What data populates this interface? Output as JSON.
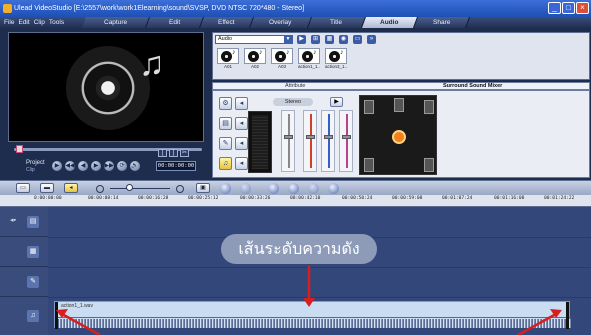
{
  "window": {
    "title": "Ulead VideoStudio [E:\\2557\\work\\work1Elearning\\sound\\SVSP, DVD NTSC 720*480 - Stereo]",
    "buttons": [
      "_",
      "□",
      "×"
    ]
  },
  "menu": [
    "File",
    "Edit",
    "Clip",
    "Tools"
  ],
  "steps": {
    "items": [
      "Capture",
      "Edit",
      "Effect",
      "Overlay",
      "Title",
      "Audio",
      "Share"
    ],
    "active": "Audio"
  },
  "playback": {
    "project_label": "Project",
    "clip_label": "Clip",
    "timecode": "00:00:00:00",
    "trim_buttons": [
      "[",
      "]",
      "✂"
    ],
    "transport": [
      "▶",
      "◀◀",
      "◀",
      "▶",
      "▶▶",
      "⟳",
      "🔊"
    ]
  },
  "library": {
    "category": "Audio",
    "items": [
      "A01",
      "A02",
      "A03",
      "action1_1...",
      "action3_1..."
    ]
  },
  "options": {
    "tabs": [
      "Attribute",
      "Surround Sound Mixer"
    ],
    "active_tab": "Surround Sound Mixer",
    "stereo_label": "Stereo",
    "fader_colors": [
      "#d04028",
      "#3060c8",
      "#b84090"
    ]
  },
  "timeline": {
    "ruler": [
      "0:00:00:00",
      "00:00:08:14",
      "00:00:16:28",
      "00:00:25:12",
      "00:00:33:26",
      "00:00:42:10",
      "00:00:50:24",
      "00:00:59:08",
      "00:01:07:24",
      "00:01:16:08",
      "00:01:24:22"
    ],
    "audio_clip_name": "action1_1.wav",
    "volume_line_color": "#d04028"
  },
  "annotation": {
    "label": "เส้นระดับความดัง",
    "arrow_color": "#d81e1e"
  }
}
